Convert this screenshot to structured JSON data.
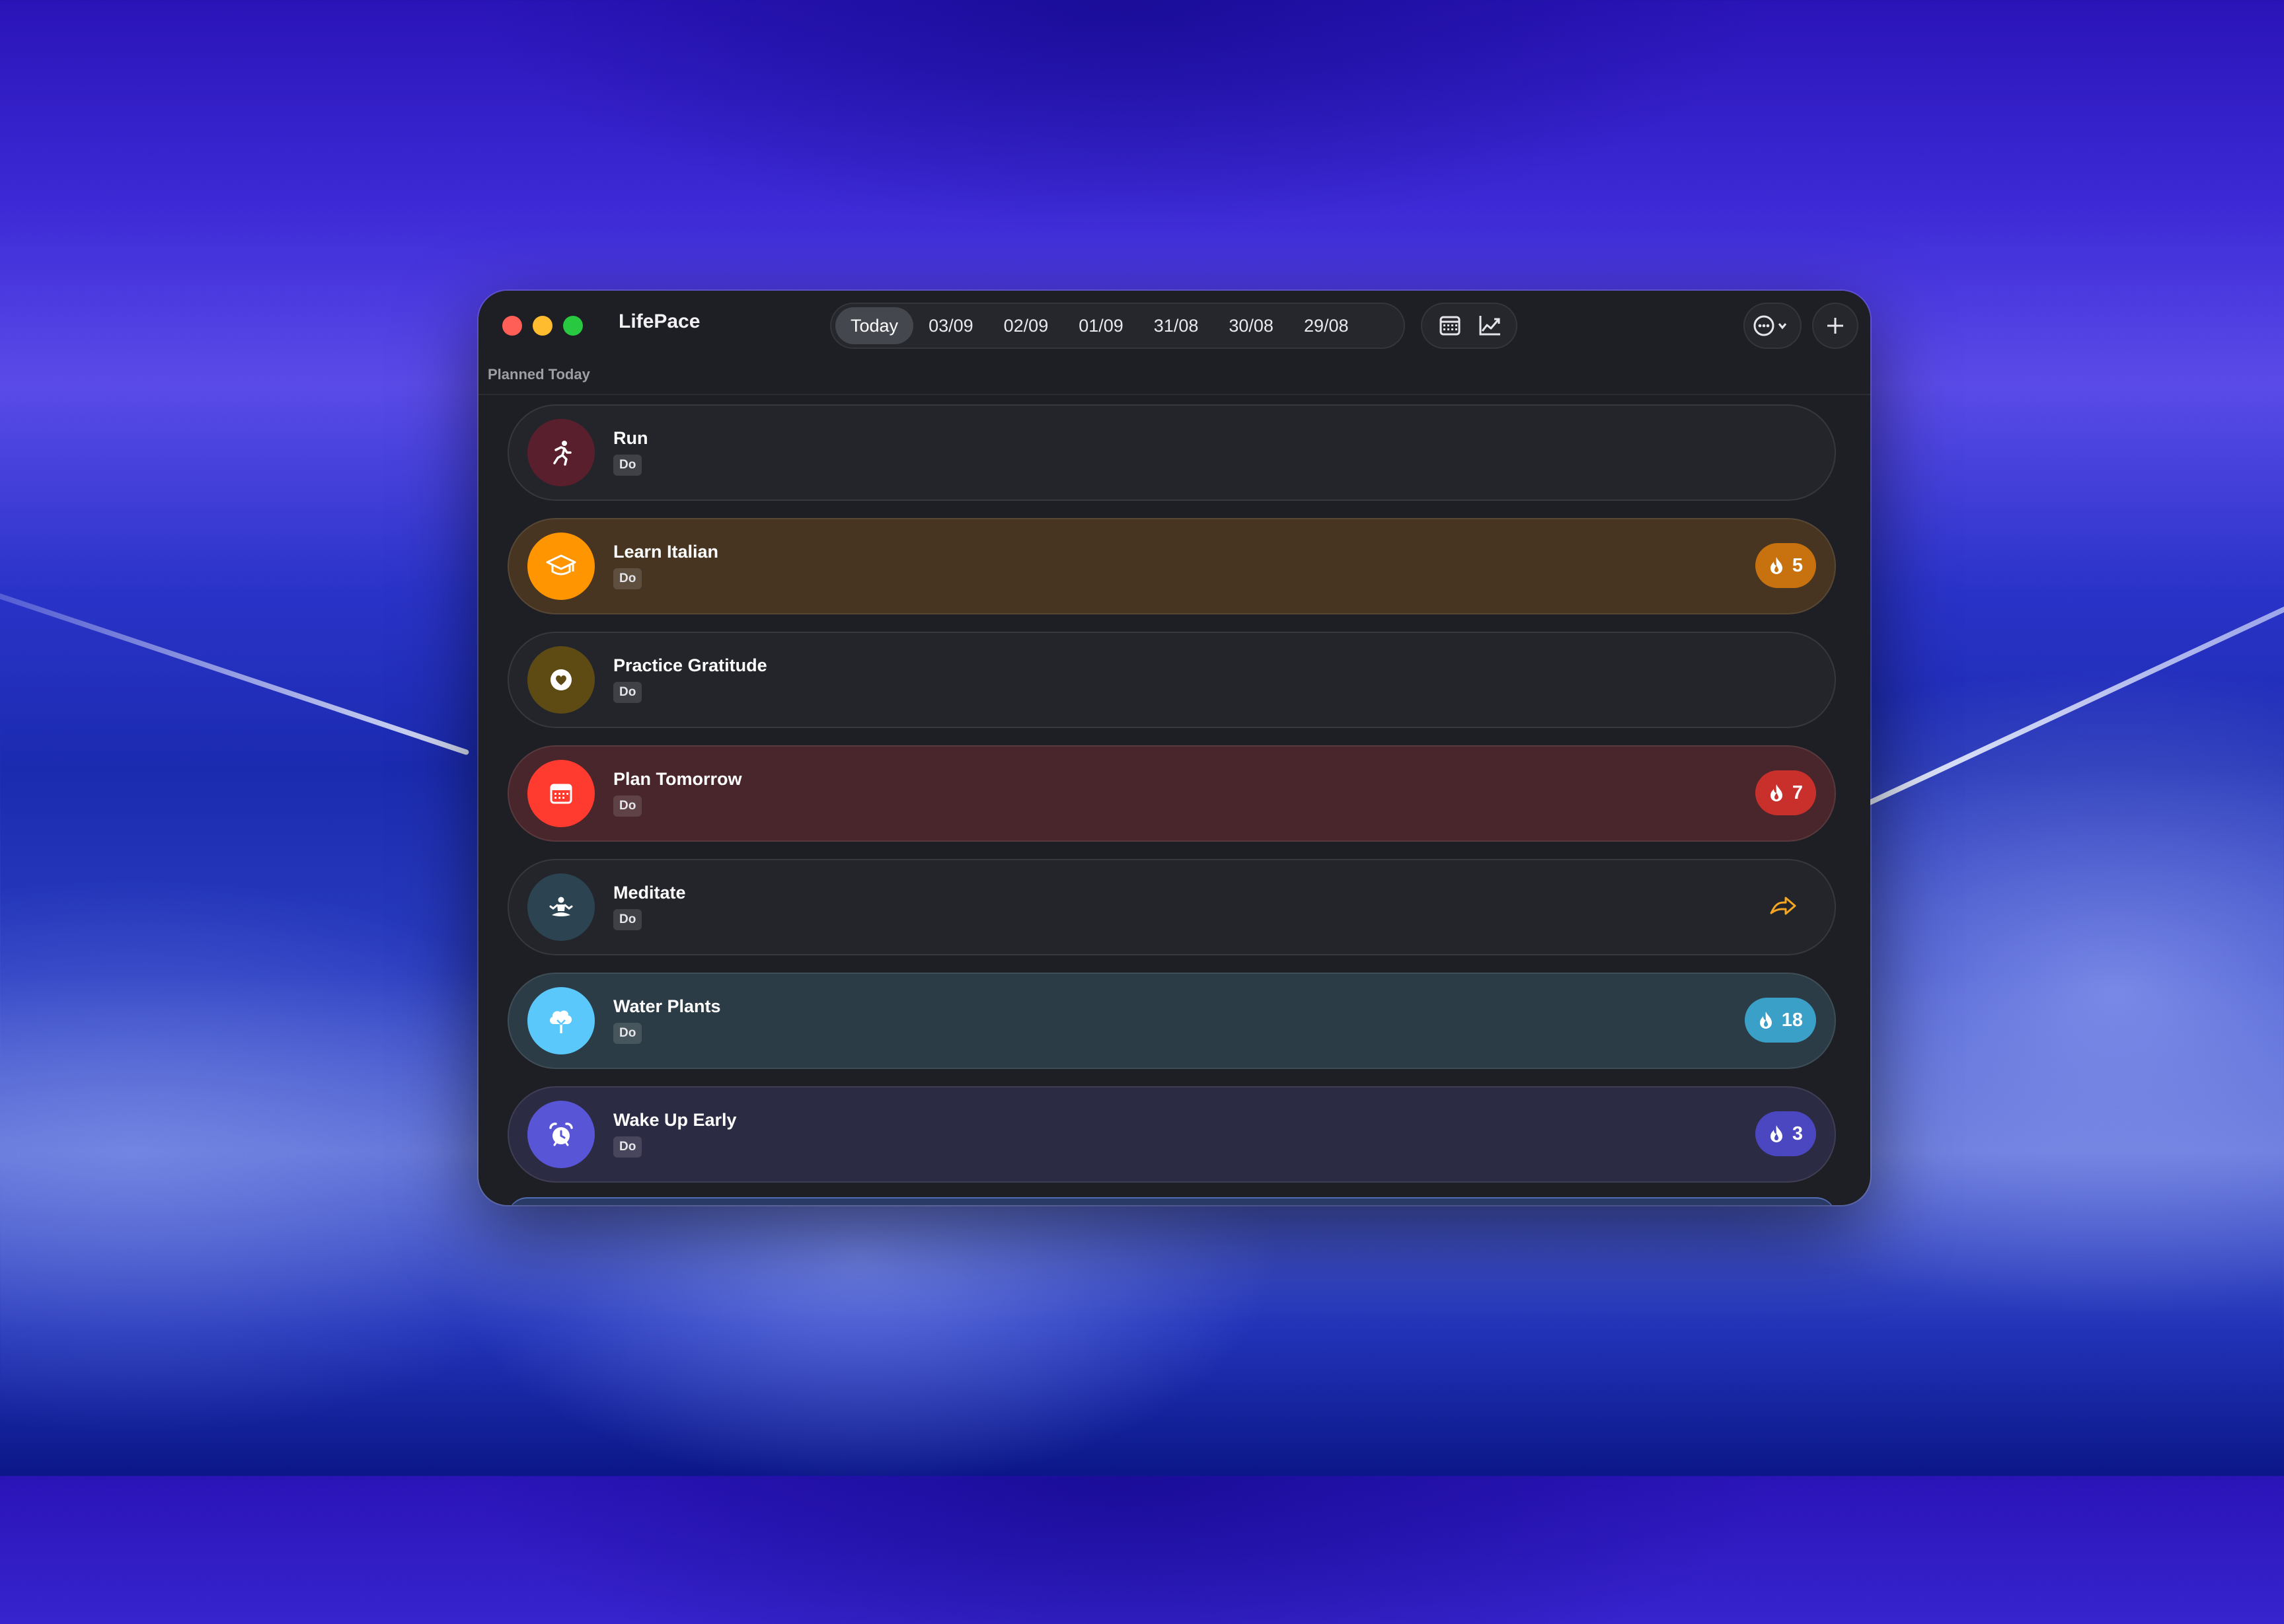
{
  "app": {
    "title": "LifePace"
  },
  "date_tabs": [
    "Today",
    "03/09",
    "02/09",
    "01/09",
    "31/08",
    "30/08",
    "29/08"
  ],
  "active_date_tab": "Today",
  "toolbar": {
    "calendar_icon": "calendar-icon",
    "chart_icon": "chart-line-icon",
    "more_icon": "ellipsis-circle-icon",
    "add_icon": "plus-icon"
  },
  "section": {
    "label": "Planned Today"
  },
  "habits": [
    {
      "name": "Run",
      "tag": "Do",
      "icon": "running-figure-icon",
      "icon_color": "#5a1f2c",
      "card_color": "#24252b",
      "streak": null
    },
    {
      "name": "Learn Italian",
      "tag": "Do",
      "icon": "graduation-cap-icon",
      "icon_color": "#ff9500",
      "card_color": "#473522",
      "streak": "5",
      "streak_color": "#c8720f"
    },
    {
      "name": "Practice Gratitude",
      "tag": "Do",
      "icon": "heart-circle-icon",
      "icon_color": "#5e4b14",
      "card_color": "#24252b",
      "streak": null
    },
    {
      "name": "Plan Tomorrow",
      "tag": "Do",
      "icon": "calendar-icon",
      "icon_color": "#ff3b30",
      "card_color": "#48262b",
      "streak": "7",
      "streak_color": "#c9302c"
    },
    {
      "name": "Meditate",
      "tag": "Do",
      "icon": "meditation-figure-icon",
      "icon_color": "#2c4452",
      "card_color": "#24252b",
      "streak": null,
      "trailing_icon": "reschedule-arrow-icon"
    },
    {
      "name": "Water Plants",
      "tag": "Do",
      "icon": "tree-icon",
      "icon_color": "#5ac8fa",
      "card_color": "#2c3c46",
      "streak": "18",
      "streak_color": "#3aa0c8"
    },
    {
      "name": "Wake Up Early",
      "tag": "Do",
      "icon": "alarm-clock-icon",
      "icon_color": "#5856d6",
      "card_color": "#2c2b44",
      "streak": "3",
      "streak_color": "#4a47c0"
    }
  ]
}
